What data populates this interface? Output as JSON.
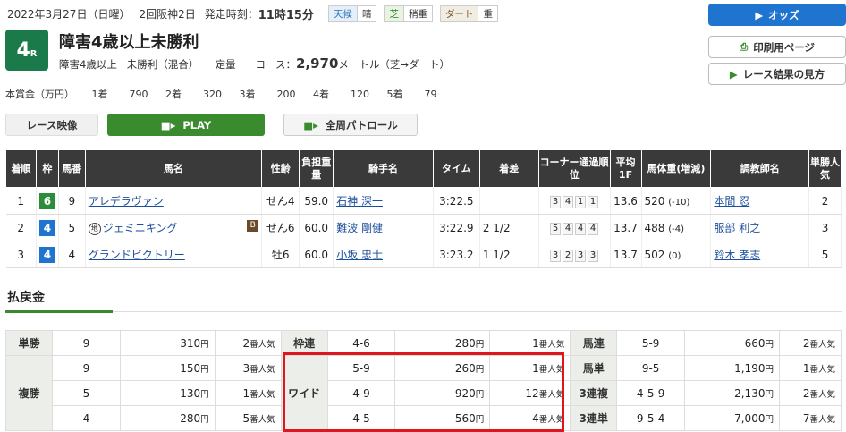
{
  "header": {
    "date": "2022年3月27日（日曜）",
    "meeting": "2回阪神2日",
    "post_label": "発走時刻：",
    "post_time": "11時15分",
    "weather_k": "天候",
    "weather_v": "晴",
    "turf_k": "芝",
    "turf_v": "稍重",
    "dirt_k": "ダート",
    "dirt_v": "重",
    "race_no": "4",
    "race_no_suffix": "R",
    "title": "障害4歳以上未勝利",
    "cond1": "障害4歳以上",
    "cond2": "未勝利（混合）",
    "cond3": "定量",
    "course_label": "コース：",
    "distance": "2,970",
    "course_unit": "メートル（芝→ダート）"
  },
  "buttons": {
    "odds": "オッズ",
    "print": "印刷用ページ",
    "guide": "レース結果の見方",
    "video": "レース映像",
    "play": "PLAY",
    "patrol": "全周パトロール"
  },
  "prize": {
    "label": "本賞金（万円）",
    "items": [
      [
        "1着",
        "790"
      ],
      [
        "2着",
        "320"
      ],
      [
        "3着",
        "200"
      ],
      [
        "4着",
        "120"
      ],
      [
        "5着",
        "79"
      ]
    ]
  },
  "results": {
    "headers": [
      "着順",
      "枠",
      "馬番",
      "馬名",
      "性齢",
      "負担重量",
      "騎手名",
      "タイム",
      "着差",
      "コーナー通過順位",
      "平均1F",
      "馬体重(増減)",
      "調教師名",
      "単勝人気"
    ],
    "rows": [
      {
        "rank": "1",
        "waku": "6",
        "waku_color": "#2d8c3a",
        "num": "9",
        "horse": "アレデラヴァン",
        "mark": "",
        "blink": "",
        "sex": "せん4",
        "wt": "59.0",
        "jockey": "石神 深一",
        "time": "3:22.5",
        "margin": "",
        "corner": [
          "3",
          "4",
          "1",
          "1"
        ],
        "f1": "13.6",
        "body": "520",
        "diff": "(-10)",
        "trainer": "本間 忍",
        "pop": "2"
      },
      {
        "rank": "2",
        "waku": "4",
        "waku_color": "#1f74d0",
        "num": "5",
        "horse": "ジェミニキング",
        "mark": "地",
        "blink": "B",
        "sex": "せん6",
        "wt": "60.0",
        "jockey": "難波 剛健",
        "time": "3:22.9",
        "margin": "2 1/2",
        "corner": [
          "5",
          "4",
          "4",
          "4"
        ],
        "f1": "13.7",
        "body": "488",
        "diff": "(-4)",
        "trainer": "服部 利之",
        "pop": "3"
      },
      {
        "rank": "3",
        "waku": "4",
        "waku_color": "#1f74d0",
        "num": "4",
        "horse": "グランドビクトリー",
        "mark": "",
        "blink": "",
        "sex": "牡6",
        "wt": "60.0",
        "jockey": "小坂 忠士",
        "time": "3:23.2",
        "margin": "1 1/2",
        "corner": [
          "3",
          "2",
          "3",
          "3"
        ],
        "f1": "13.7",
        "body": "502",
        "diff": "(0)",
        "trainer": "鈴木 孝志",
        "pop": "5"
      }
    ]
  },
  "payout": {
    "title": "払戻金",
    "yen": "円",
    "pop_suffix": "番人気",
    "tansho_k": "単勝",
    "tansho": [
      "9",
      "310",
      "2"
    ],
    "fukusho_k": "複勝",
    "fukusho": [
      [
        "9",
        "150",
        "3"
      ],
      [
        "5",
        "130",
        "1"
      ],
      [
        "4",
        "280",
        "5"
      ]
    ],
    "wakuren_k": "枠連",
    "wakuren": [
      "4-6",
      "280",
      "1"
    ],
    "wide_k": "ワイド",
    "wide": [
      [
        "5-9",
        "260",
        "1"
      ],
      [
        "4-9",
        "920",
        "12"
      ],
      [
        "4-5",
        "560",
        "4"
      ]
    ],
    "umaren_k": "馬連",
    "umaren": [
      "5-9",
      "660",
      "2"
    ],
    "umatan_k": "馬単",
    "umatan": [
      "9-5",
      "1,190",
      "1"
    ],
    "sanfuku_k": "3連複",
    "sanfuku": [
      "4-5-9",
      "2,130",
      "2"
    ],
    "santan_k": "3連単",
    "santan": [
      "9-5-4",
      "7,000",
      "7"
    ]
  },
  "colors": {
    "accent_green": "#3a8b2e",
    "odds_blue": "#1f74d0",
    "highlight_red": "#e0161d"
  }
}
